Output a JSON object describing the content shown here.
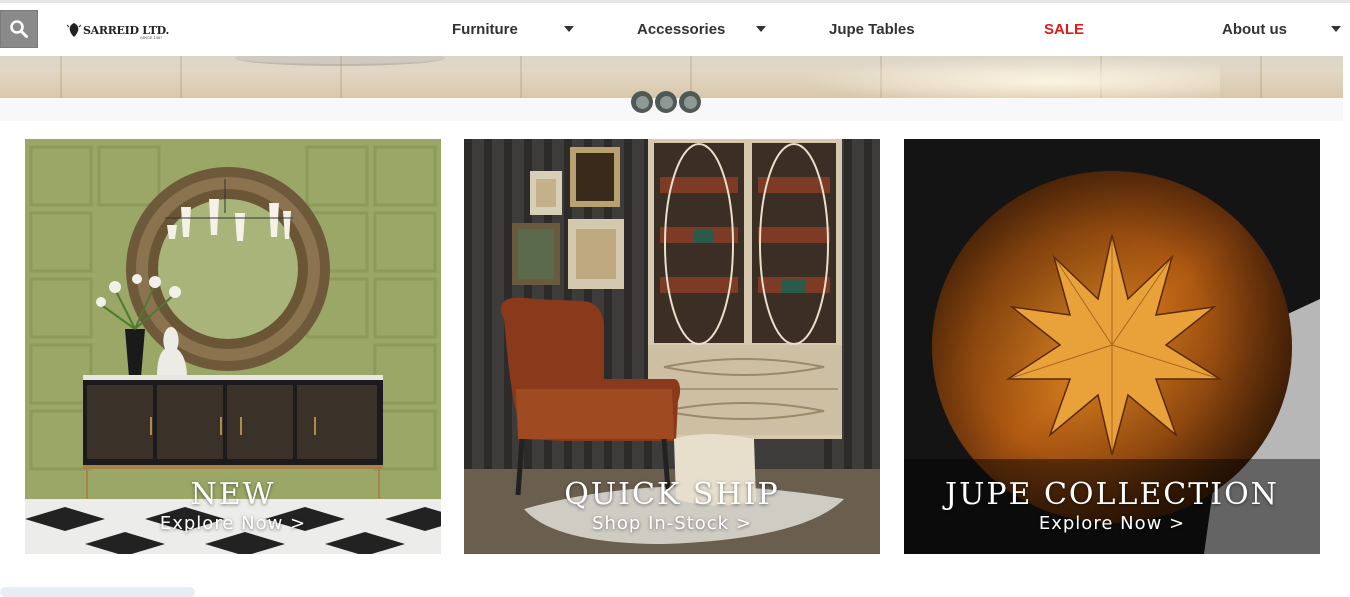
{
  "brand": {
    "logo_text": "SARREID LTD.",
    "logo_since": "SINCE 1967"
  },
  "nav": {
    "items": [
      {
        "label": "Furniture",
        "has_dropdown": true
      },
      {
        "label": "Accessories",
        "has_dropdown": true
      },
      {
        "label": "Jupe Tables",
        "has_dropdown": false
      },
      {
        "label": "SALE",
        "has_dropdown": false
      },
      {
        "label": "About us",
        "has_dropdown": true
      }
    ]
  },
  "carousel": {
    "slides": 3,
    "active": 1
  },
  "tiles": [
    {
      "title": "NEW",
      "link": "Explore Now >"
    },
    {
      "title": "QUICK SHIP",
      "link": "Shop In-Stock >"
    },
    {
      "title": "JUPE COLLECTION",
      "link": "Explore Now >"
    }
  ],
  "colors": {
    "sale": "#e01b1b",
    "search_button": "#8a8a8a",
    "carousel_dot": "#4f5a57"
  },
  "icons": [
    "search-icon",
    "chevron-down-icon"
  ]
}
